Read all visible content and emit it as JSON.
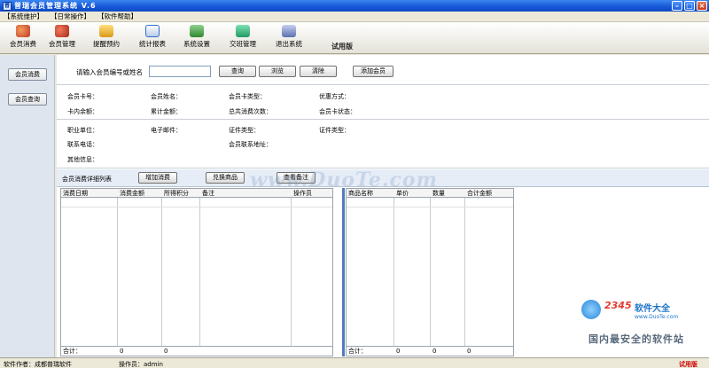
{
  "window": {
    "title": "普瑞会员管理系统 V.6"
  },
  "menu": {
    "items": [
      "【系统维护】",
      "【日常操作】",
      "【软件帮助】"
    ]
  },
  "toolbar": {
    "items": [
      {
        "label": "会员消费",
        "icon": "member-consume-icon",
        "color": "#d9552b"
      },
      {
        "label": "会员管理",
        "icon": "members-icon",
        "color": "#c0392b"
      },
      {
        "label": "提醒预约",
        "icon": "reminder-icon",
        "color": "#e0a820"
      },
      {
        "label": "统计报表",
        "icon": "report-icon",
        "color": "#2e6fd1"
      },
      {
        "label": "系统设置",
        "icon": "settings-icon",
        "color": "#3b9a3b"
      },
      {
        "label": "交班管理",
        "icon": "handover-icon",
        "color": "#1f9c63"
      },
      {
        "label": "退出系统",
        "icon": "exit-icon",
        "color": "#5b6fb0"
      }
    ],
    "trial": "试用版"
  },
  "sidebar": {
    "items": [
      "会员消费",
      "会员查询"
    ]
  },
  "search": {
    "label": "请输入会员编号或姓名",
    "value": "",
    "buttons": {
      "query": "查询",
      "browse": "浏览",
      "clear": "清除",
      "add_member": "添加会员"
    }
  },
  "info": {
    "card_no": "会员卡号：",
    "name": "会员姓名：",
    "card_type": "会员卡类型：",
    "discount": "优惠方式：",
    "balance": "卡内余额：",
    "total_amount": "累计金额：",
    "total_times": "总共消费次数：",
    "card_status": "会员卡状态：",
    "work_unit": "职业单位：",
    "email": "电子邮件：",
    "id_type": "证件类型：",
    "id_type2": "证件类型：",
    "phone": "联系电话：",
    "address": "会员联系地址：",
    "other": "其他信息："
  },
  "detail": {
    "title": "会员消费详细列表",
    "buttons": {
      "add_consume": "增加消费",
      "redeem": "兑换商品",
      "view_notes": "查看备注"
    }
  },
  "left_grid": {
    "columns": [
      "消费日期",
      "消费金额",
      "所得积分",
      "备注",
      "操作员"
    ],
    "total_label": "合计：",
    "totals": [
      "0",
      "0"
    ]
  },
  "right_grid": {
    "columns": [
      "商品名称",
      "单价",
      "数量",
      "合计金额"
    ],
    "total_label": "合计：",
    "totals": [
      "0",
      "0",
      "0"
    ]
  },
  "watermark": {
    "site": "www.DuoTe.com",
    "brand_num": "2345",
    "brand_text": "软件大全",
    "url": "www.DuoTe.com",
    "slogan": "国内最安全的软件站"
  },
  "status": {
    "author": "软件作者：成都普瑞软件",
    "operator": "操作员：admin",
    "trial": "试用版",
    "trial_color": "#cc0000"
  }
}
